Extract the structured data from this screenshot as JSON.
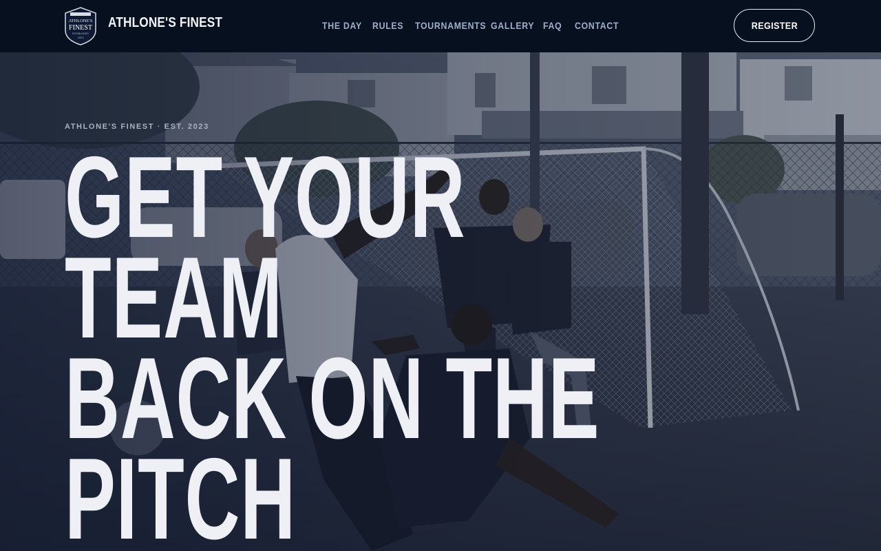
{
  "header": {
    "brand": "ATHLONE'S FINEST",
    "logo": {
      "top_text": "ATHLONE'S",
      "main_text": "FINEST",
      "sub_text": "ESTABLISHED",
      "year": "2023"
    },
    "nav": [
      {
        "label": "THE DAY"
      },
      {
        "label": "RULES"
      },
      {
        "label": "TOURNAMENTS"
      },
      {
        "label": "GALLERY"
      },
      {
        "label": "FAQ"
      },
      {
        "label": "CONTACT"
      }
    ],
    "register_label": "REGISTER"
  },
  "hero": {
    "eyebrow": "ATHLONE'S FINEST · EST. 2023",
    "headline": [
      "GET YOUR",
      "TEAM",
      "BACK ON THE",
      "PITCH"
    ],
    "image": "five-a-side football match in front of a goal"
  },
  "colors": {
    "nav_bg": "#07101f",
    "nav_text": "#9fb0cb",
    "headline": "#eef0f6",
    "overlay": "#0e162e"
  }
}
